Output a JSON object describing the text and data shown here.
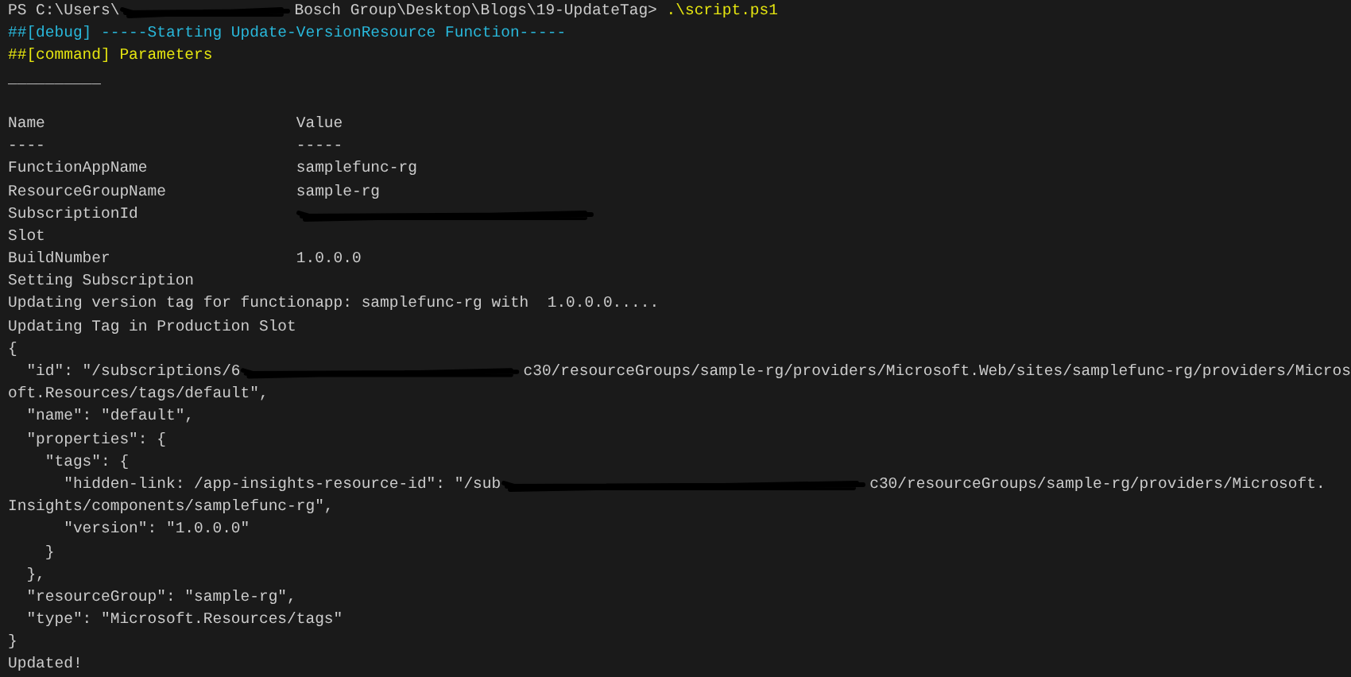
{
  "terminal": {
    "lines": [
      {
        "segments": [
          {
            "kind": "text",
            "text": "PS C:\\Users\\"
          },
          {
            "kind": "short-redaction"
          },
          {
            "kind": "text",
            "text": "Bosch Group\\Desktop\\Blogs\\19-UpdateTag> "
          },
          {
            "kind": "text",
            "text": ".\\script.ps1",
            "color": "#e5e510"
          }
        ]
      },
      {
        "segments": [
          {
            "kind": "text",
            "text": "##[debug] -----Starting Update-VersionResource Function-----",
            "color": "#29b8db"
          }
        ]
      },
      {
        "segments": [
          {
            "kind": "text",
            "text": "##[command] Parameters",
            "color": "#e5e510"
          }
        ]
      },
      {
        "segments": [
          {
            "kind": "text",
            "text": "__________"
          }
        ]
      },
      {
        "kind": "blank"
      },
      {
        "segments": [
          {
            "kind": "text",
            "text": "Name                           Value"
          }
        ]
      },
      {
        "segments": [
          {
            "kind": "text",
            "text": "----                           -----"
          }
        ]
      },
      {
        "segments": [
          {
            "kind": "text",
            "text": "FunctionAppName                samplefunc-rg"
          }
        ]
      },
      {
        "segments": [
          {
            "kind": "text",
            "text": "ResourceGroupName              sample-rg"
          }
        ]
      },
      {
        "segments": [
          {
            "kind": "text",
            "text": "SubscriptionId"
          },
          {
            "kind": "column-redaction"
          }
        ]
      },
      {
        "segments": [
          {
            "kind": "text",
            "text": "Slot"
          }
        ]
      },
      {
        "segments": [
          {
            "kind": "text",
            "text": "BuildNumber                    1.0.0.0"
          }
        ]
      },
      {
        "segments": [
          {
            "kind": "text",
            "text": "Setting Subscription"
          }
        ]
      },
      {
        "segments": [
          {
            "kind": "text",
            "text": "Updating version tag for functionapp: samplefunc-rg with  1.0.0.0....."
          }
        ]
      },
      {
        "segments": [
          {
            "kind": "text",
            "text": "Updating Tag in Production Slot"
          }
        ]
      },
      {
        "segments": [
          {
            "kind": "text",
            "text": "{"
          }
        ]
      },
      {
        "segments": [
          {
            "kind": "text",
            "text": "  \"id\": \"/subscriptions/6"
          },
          {
            "kind": "medium-redaction"
          },
          {
            "kind": "text",
            "text": "c30/resourceGroups/sample-rg/providers/Microsoft.Web/sites/samplefunc-rg/providers/Micros"
          }
        ]
      },
      {
        "segments": [
          {
            "kind": "text",
            "text": "oft.Resources/tags/default\","
          }
        ]
      },
      {
        "segments": [
          {
            "kind": "text",
            "text": "  \"name\": \"default\","
          }
        ]
      },
      {
        "segments": [
          {
            "kind": "text",
            "text": "  \"properties\": {"
          }
        ]
      },
      {
        "segments": [
          {
            "kind": "text",
            "text": "    \"tags\": {"
          }
        ]
      },
      {
        "segments": [
          {
            "kind": "text",
            "text": "      \"hidden-link: /app-insights-resource-id\": \"/sub"
          },
          {
            "kind": "long-redaction"
          },
          {
            "kind": "text",
            "text": "c30/resourceGroups/sample-rg/providers/Microsoft."
          }
        ]
      },
      {
        "segments": [
          {
            "kind": "text",
            "text": "Insights/components/samplefunc-rg\","
          }
        ]
      },
      {
        "segments": [
          {
            "kind": "text",
            "text": "      \"version\": \"1.0.0.0\""
          }
        ]
      },
      {
        "segments": [
          {
            "kind": "text",
            "text": "    }"
          }
        ]
      },
      {
        "segments": [
          {
            "kind": "text",
            "text": "  },"
          }
        ]
      },
      {
        "segments": [
          {
            "kind": "text",
            "text": "  \"resourceGroup\": \"sample-rg\","
          }
        ]
      },
      {
        "segments": [
          {
            "kind": "text",
            "text": "  \"type\": \"Microsoft.Resources/tags\""
          }
        ]
      },
      {
        "segments": [
          {
            "kind": "text",
            "text": "}"
          }
        ]
      },
      {
        "segments": [
          {
            "kind": "text",
            "text": "Updated!"
          }
        ]
      }
    ]
  }
}
